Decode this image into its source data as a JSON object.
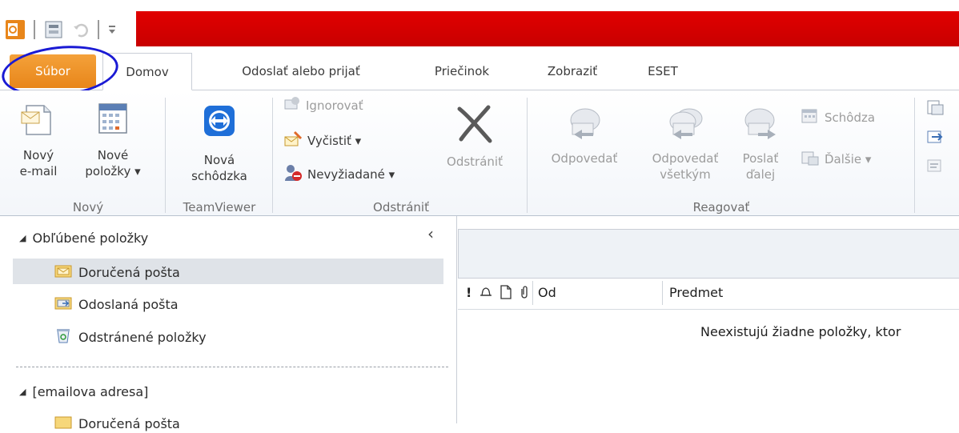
{
  "tabs": {
    "file": "Súbor",
    "home": "Domov",
    "send_receive": "Odoslať alebo prijať",
    "folder": "Priečinok",
    "view": "Zobraziť",
    "eset": "ESET"
  },
  "ribbon": {
    "new_group": {
      "label": "Nový",
      "new_email_1": "Nový",
      "new_email_2": "e-mail",
      "new_items_1": "Nové",
      "new_items_2": "položky ▾"
    },
    "teamviewer_group": {
      "label": "TeamViewer",
      "new_meeting_1": "Nová",
      "new_meeting_2": "schôdzka"
    },
    "delete_group": {
      "label": "Odstrániť",
      "ignore": "Ignorovať",
      "clean_up": "Vyčistiť ▾",
      "junk": "Nevyžiadané ▾",
      "delete": "Odstrániť"
    },
    "respond_group": {
      "label": "Reagovať",
      "reply": "Odpovedať",
      "reply_all_1": "Odpovedať",
      "reply_all_2": "všetkým",
      "forward_1": "Poslať",
      "forward_2": "ďalej",
      "meeting": "Schôdza",
      "more": "Ďalšie ▾"
    }
  },
  "nav": {
    "favorites_header": "Obľúbené položky",
    "collapse": "‹",
    "inbox": "Doručená pošta",
    "sent": "Odoslaná pošta",
    "deleted": "Odstránené položky",
    "account_header": "[emailova adresa]",
    "account_inbox": "Doručená pošta"
  },
  "content": {
    "col_importance": "!",
    "col_from": "Od",
    "col_subject": "Predmet",
    "empty_message": "Neexistujú žiadne položky, ktor"
  },
  "colors": {
    "file_tab": "#e8861a",
    "title_bar": "#d40000",
    "annotation_circle": "#1a1ad4",
    "selected_row": "#dfe3e8"
  }
}
